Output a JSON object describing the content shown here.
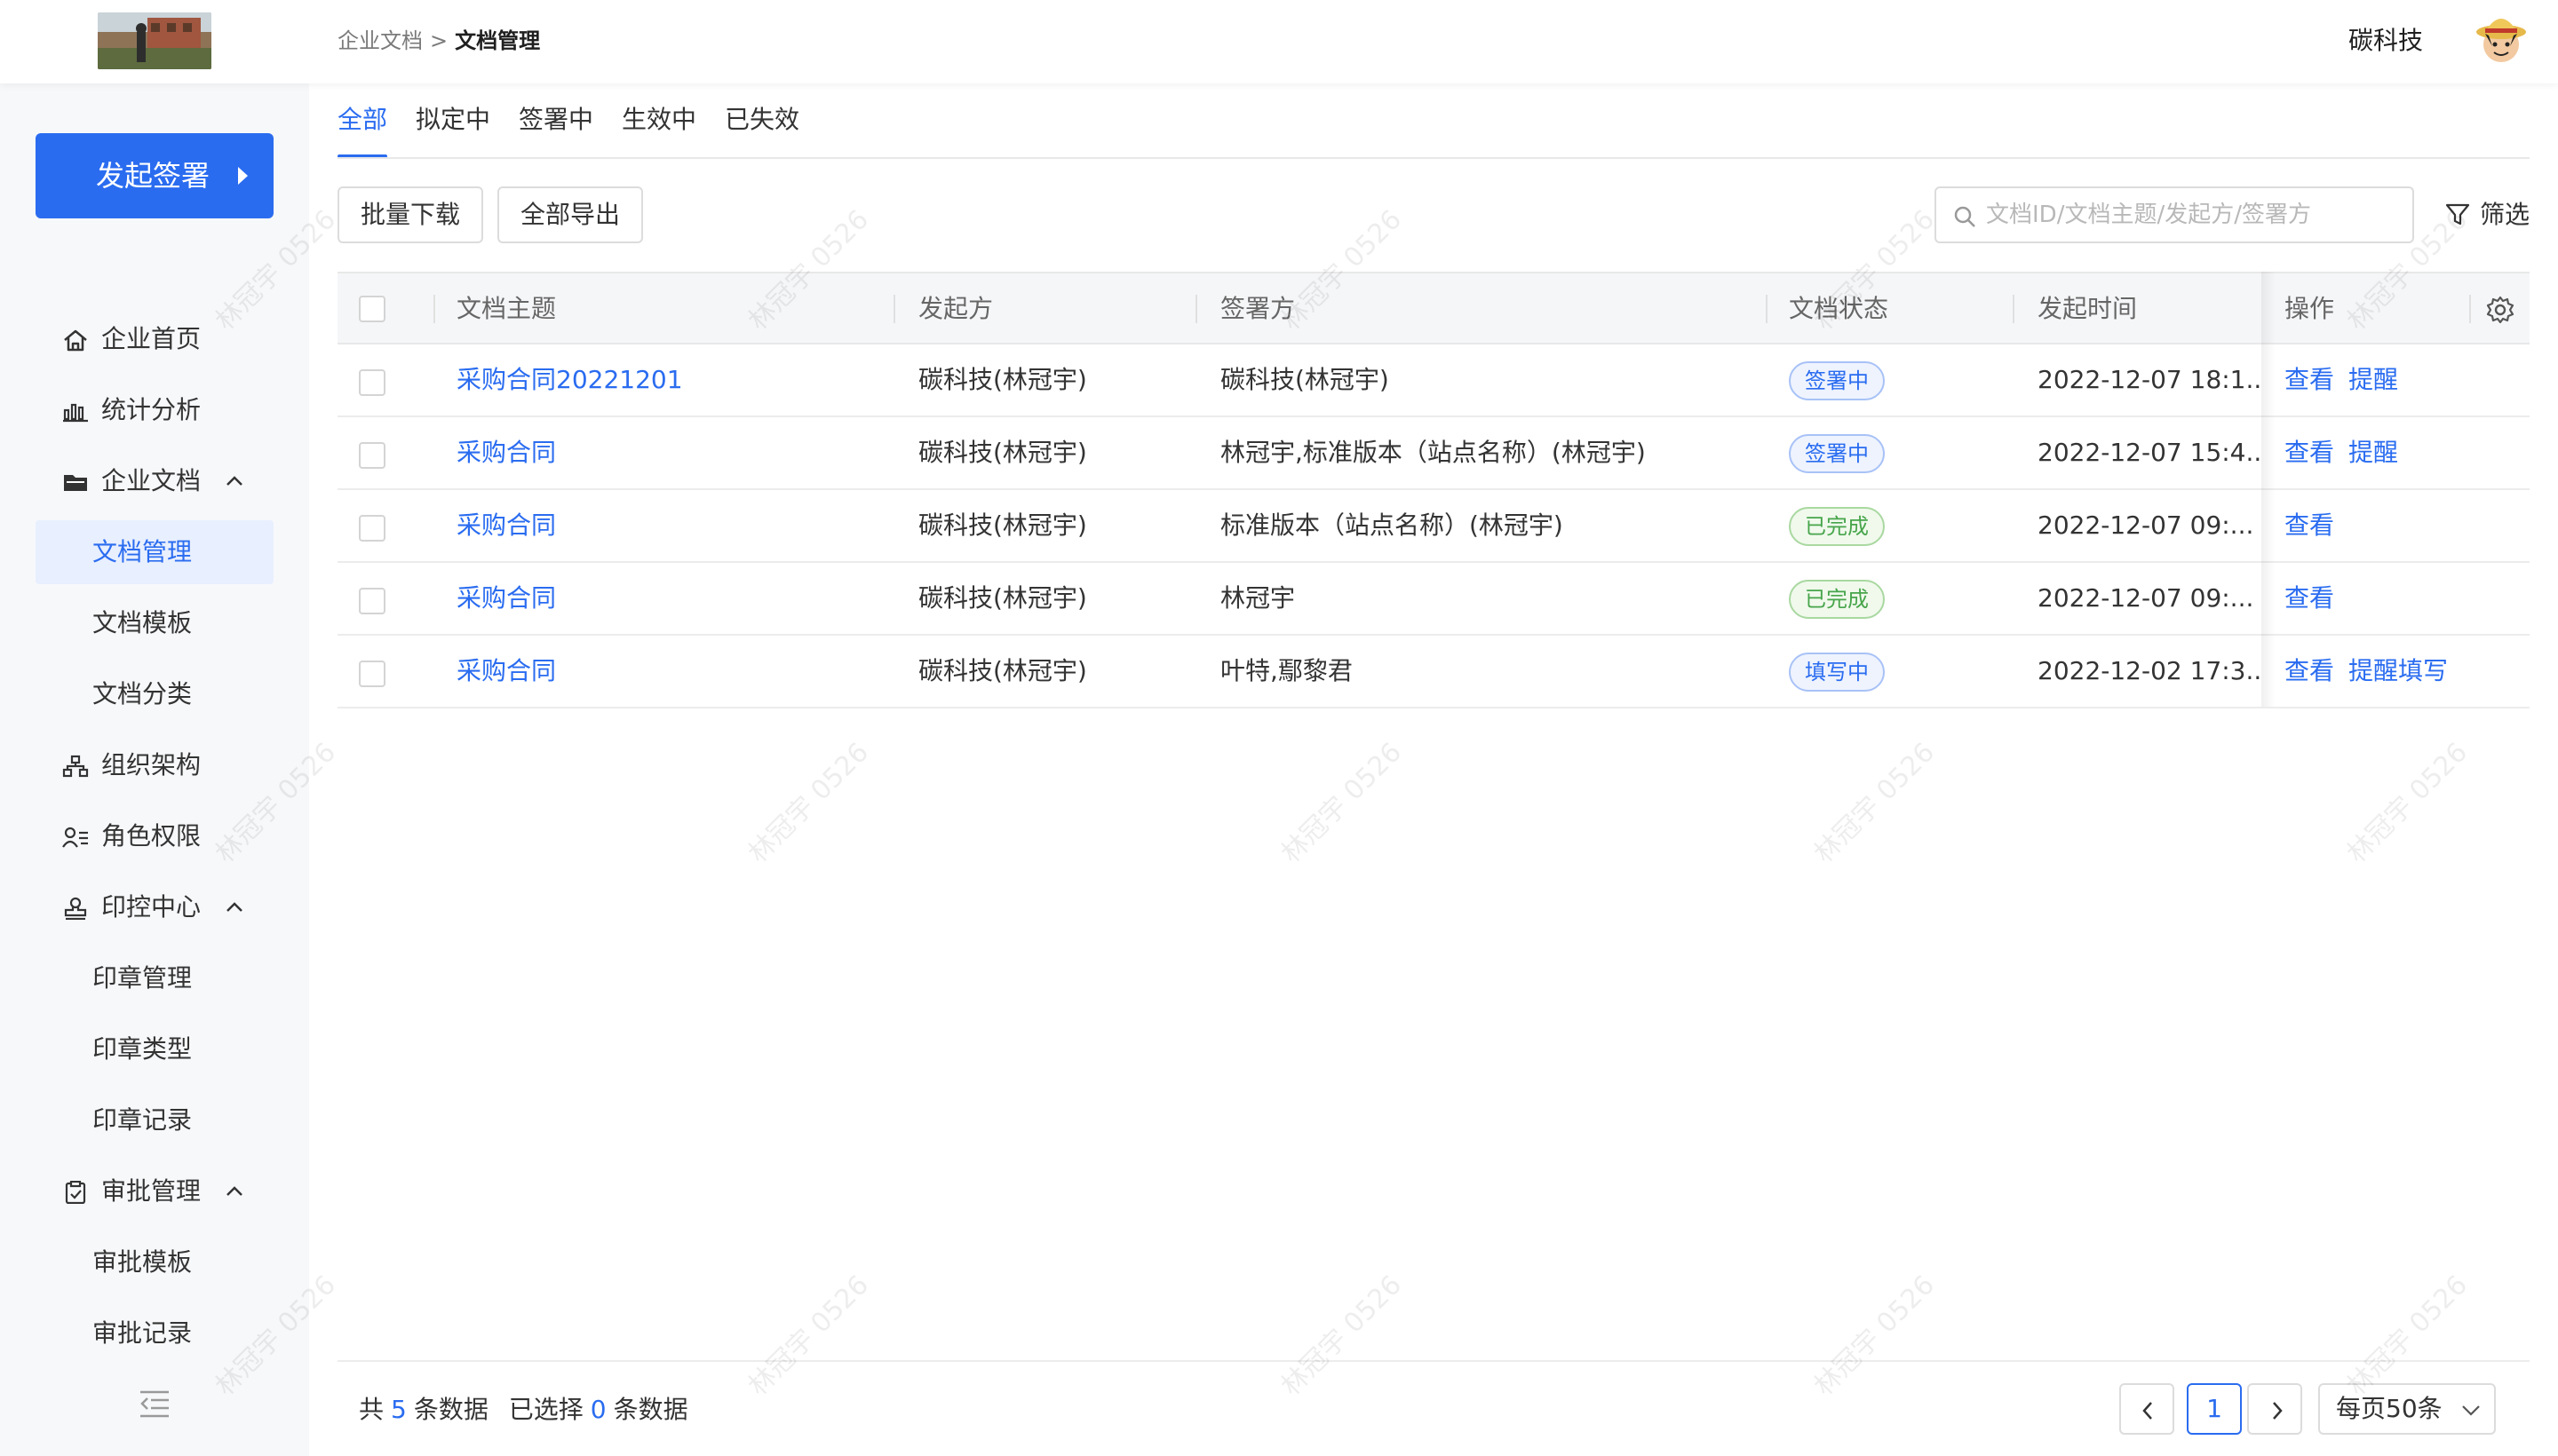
{
  "header": {
    "breadcrumb": [
      "企业文档",
      "文档管理"
    ],
    "breadcrumb_sep": ">",
    "user_name": "碳科技"
  },
  "sidebar": {
    "start_button": "发起签署",
    "items": [
      {
        "label": "企业首页",
        "icon": "home-icon"
      },
      {
        "label": "统计分析",
        "icon": "chart-icon"
      },
      {
        "label": "企业文档",
        "icon": "folder-icon",
        "expanded": true
      },
      {
        "label": "文档管理",
        "sub": true,
        "active": true
      },
      {
        "label": "文档模板",
        "sub": true
      },
      {
        "label": "文档分类",
        "sub": true
      },
      {
        "label": "组织架构",
        "icon": "org-chart-icon"
      },
      {
        "label": "角色权限",
        "icon": "user-role-icon"
      },
      {
        "label": "印控中心",
        "icon": "stamp-icon",
        "expanded": true
      },
      {
        "label": "印章管理",
        "sub": true
      },
      {
        "label": "印章类型",
        "sub": true
      },
      {
        "label": "印章记录",
        "sub": true
      },
      {
        "label": "审批管理",
        "icon": "clipboard-check-icon",
        "expanded": true
      },
      {
        "label": "审批模板",
        "sub": true
      },
      {
        "label": "审批记录",
        "sub": true
      }
    ]
  },
  "tabs": [
    {
      "label": "全部",
      "active": true
    },
    {
      "label": "拟定中"
    },
    {
      "label": "签署中"
    },
    {
      "label": "生效中"
    },
    {
      "label": "已失效"
    }
  ],
  "toolbar": {
    "batch_download": "批量下载",
    "export_all": "全部导出",
    "search_placeholder": "文档ID/文档主题/发起方/签署方",
    "filter_label": "筛选"
  },
  "table": {
    "headers": [
      "文档主题",
      "发起方",
      "签署方",
      "文档状态",
      "发起时间",
      "操作"
    ],
    "rows": [
      {
        "subject": "采购合同20221201",
        "initiator": "碳科技(林冠宇)",
        "signers": "碳科技(林冠宇)",
        "status": "签署中",
        "status_type": "signing",
        "time": "2022-12-07 18:1...",
        "actions": [
          "查看",
          "提醒"
        ]
      },
      {
        "subject": "采购合同",
        "initiator": "碳科技(林冠宇)",
        "signers": "林冠宇,标准版本（站点名称）(林冠宇)",
        "status": "签署中",
        "status_type": "signing",
        "time": "2022-12-07 15:4...",
        "actions": [
          "查看",
          "提醒"
        ]
      },
      {
        "subject": "采购合同",
        "initiator": "碳科技(林冠宇)",
        "signers": "标准版本（站点名称）(林冠宇)",
        "status": "已完成",
        "status_type": "done",
        "time": "2022-12-07 09:...",
        "actions": [
          "查看"
        ]
      },
      {
        "subject": "采购合同",
        "initiator": "碳科技(林冠宇)",
        "signers": "林冠宇",
        "status": "已完成",
        "status_type": "done",
        "time": "2022-12-07 09:...",
        "actions": [
          "查看"
        ]
      },
      {
        "subject": "采购合同",
        "initiator": "碳科技(林冠宇)",
        "signers": "叶特,鄢黎君",
        "status": "填写中",
        "status_type": "fill",
        "time": "2022-12-02 17:3...",
        "actions": [
          "查看",
          "提醒填写"
        ]
      }
    ]
  },
  "footer": {
    "total_prefix": "共",
    "total_count": "5",
    "total_suffix": "条数据",
    "selected_prefix": "已选择",
    "selected_count": "0",
    "selected_suffix": "条数据",
    "current_page": "1",
    "page_size": "每页50条"
  },
  "watermark": "林冠宇 0526",
  "colors": {
    "primary": "#2a6cf0",
    "success": "#47a54b",
    "sidebar_bg": "#f7f8fa"
  }
}
